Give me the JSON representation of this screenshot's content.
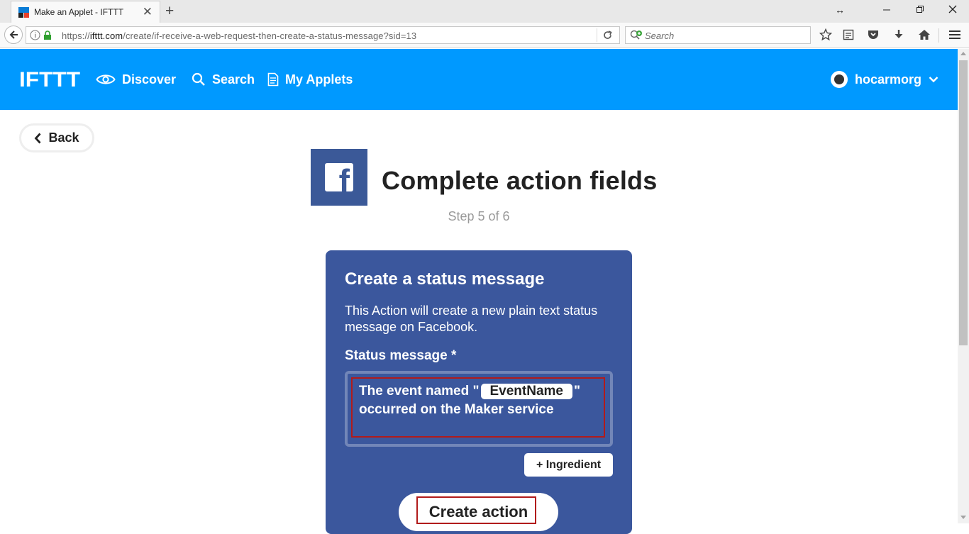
{
  "browser": {
    "tab_title": "Make an Applet - IFTTT",
    "url_prefix": "https://",
    "url_host": "ifttt.com",
    "url_path": "/create/if-receive-a-web-request-then-create-a-status-message?sid=13",
    "search_placeholder": "Search"
  },
  "header": {
    "logo_text": "IFTTT",
    "nav": {
      "discover": "Discover",
      "search": "Search",
      "my_applets": "My Applets"
    },
    "username": "hocarmorg"
  },
  "page": {
    "back_label": "Back",
    "title": "Complete action fields",
    "step": "Step 5 of 6"
  },
  "card": {
    "title": "Create a status message",
    "description": "This Action will create a new plain text status message on Facebook.",
    "field_label": "Status message *",
    "field_text_before": "The event named \"",
    "ingredient": "EventName",
    "field_text_after": "\" occurred on the Maker service",
    "ingredient_button": "+ Ingredient",
    "submit_button": "Create action"
  },
  "colors": {
    "ifttt_blue": "#0099ff",
    "facebook_blue": "#3b5998",
    "card_bg": "#3b579d",
    "highlight": "#b11b1b"
  }
}
